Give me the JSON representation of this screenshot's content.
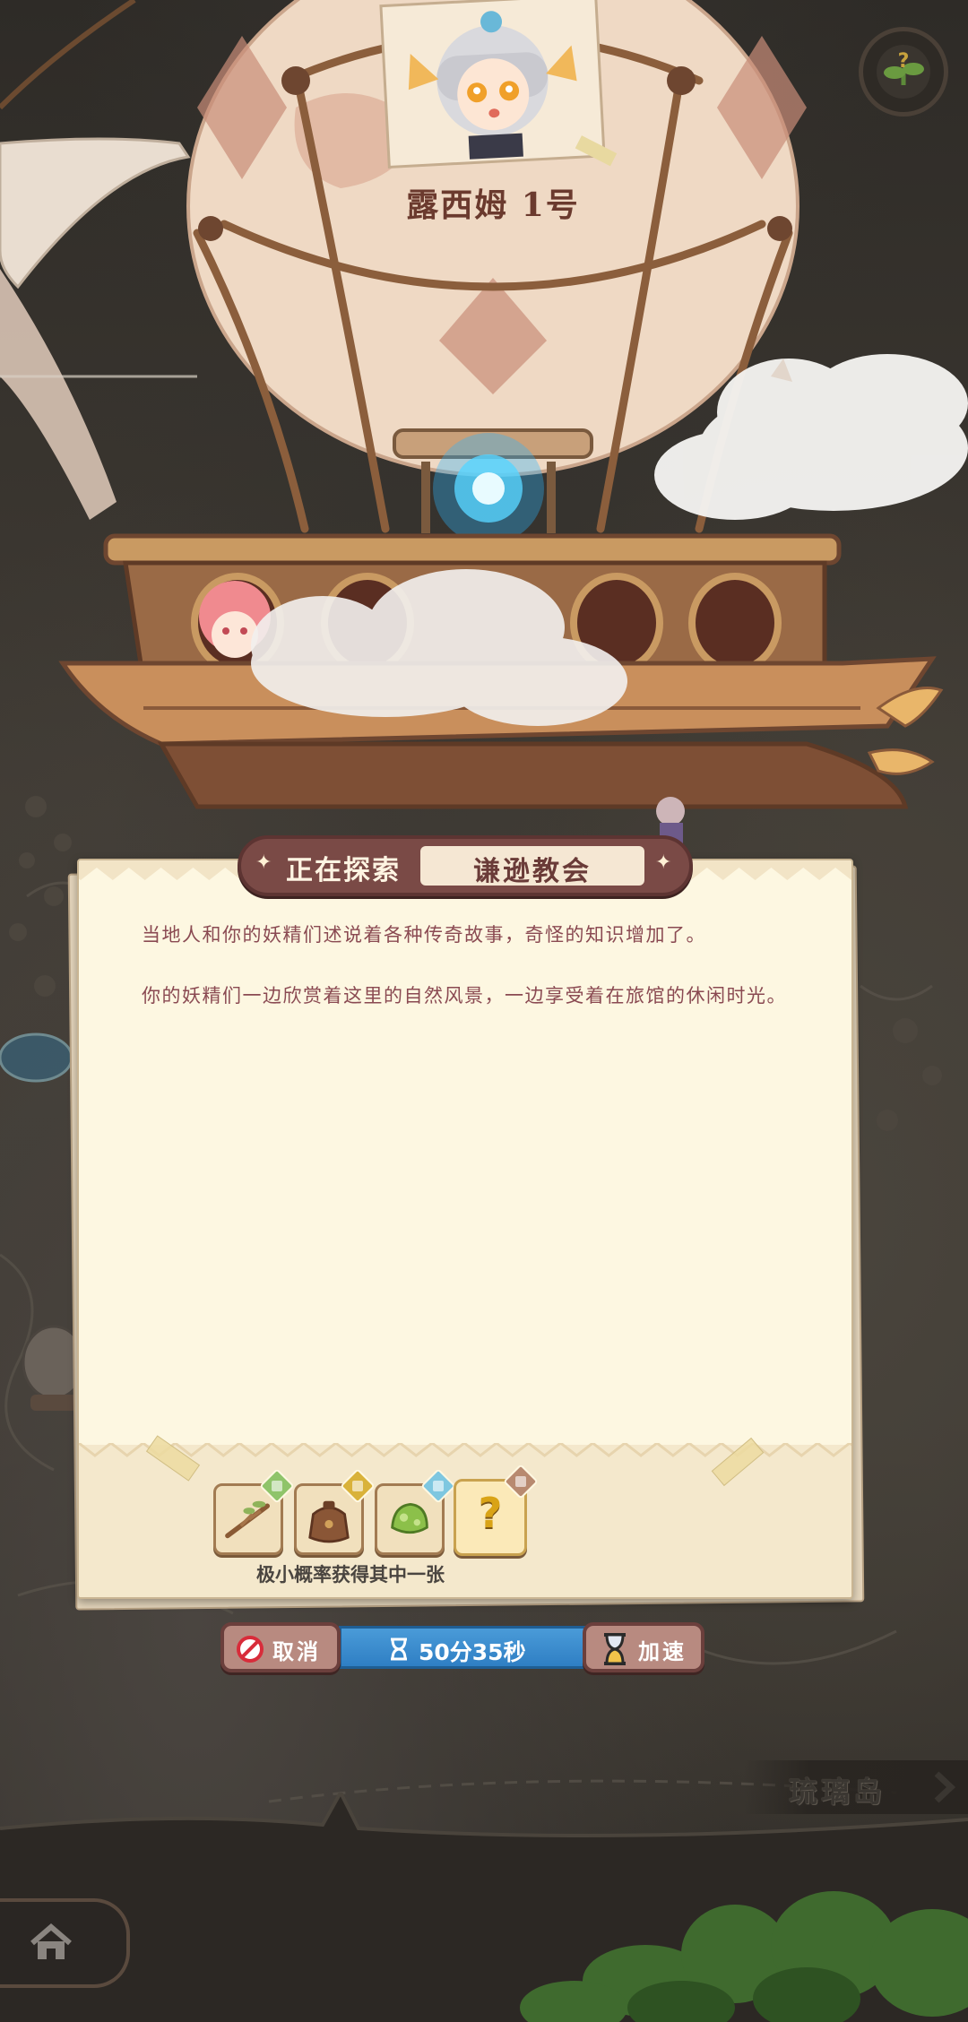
{
  "expedition": {
    "airship_name": "露西姆 1号",
    "status_label": "正在探索",
    "destination": "谦逊教会",
    "story": [
      "当地人和你的妖精们述说着各种传奇故事，奇怪的知识增加了。",
      "你的妖精们一边欣赏着这里的自然风景，一边享受着在旅馆的休闲时光。"
    ]
  },
  "rewards": {
    "caption": "极小概率获得其中一张",
    "cards": [
      {
        "icon": "branch-icon",
        "badge_color": "#8fc46a"
      },
      {
        "icon": "leather-bag-icon",
        "badge_color": "#d9b23a"
      },
      {
        "icon": "green-slime-icon",
        "badge_color": "#7ec7e0"
      },
      {
        "icon": "question-mark-icon",
        "badge_color": "#b88a70",
        "label": "?"
      }
    ]
  },
  "actions": {
    "cancel_label": "取消",
    "timer_text": "50分35秒",
    "speed_up_label": "加速"
  },
  "navigation": {
    "next_island": "琉璃岛"
  },
  "colors": {
    "banner": "#7a4a46",
    "panel": "#fdf7e1",
    "story_text": "#8a4a52",
    "timer": "#2f7fc4"
  }
}
